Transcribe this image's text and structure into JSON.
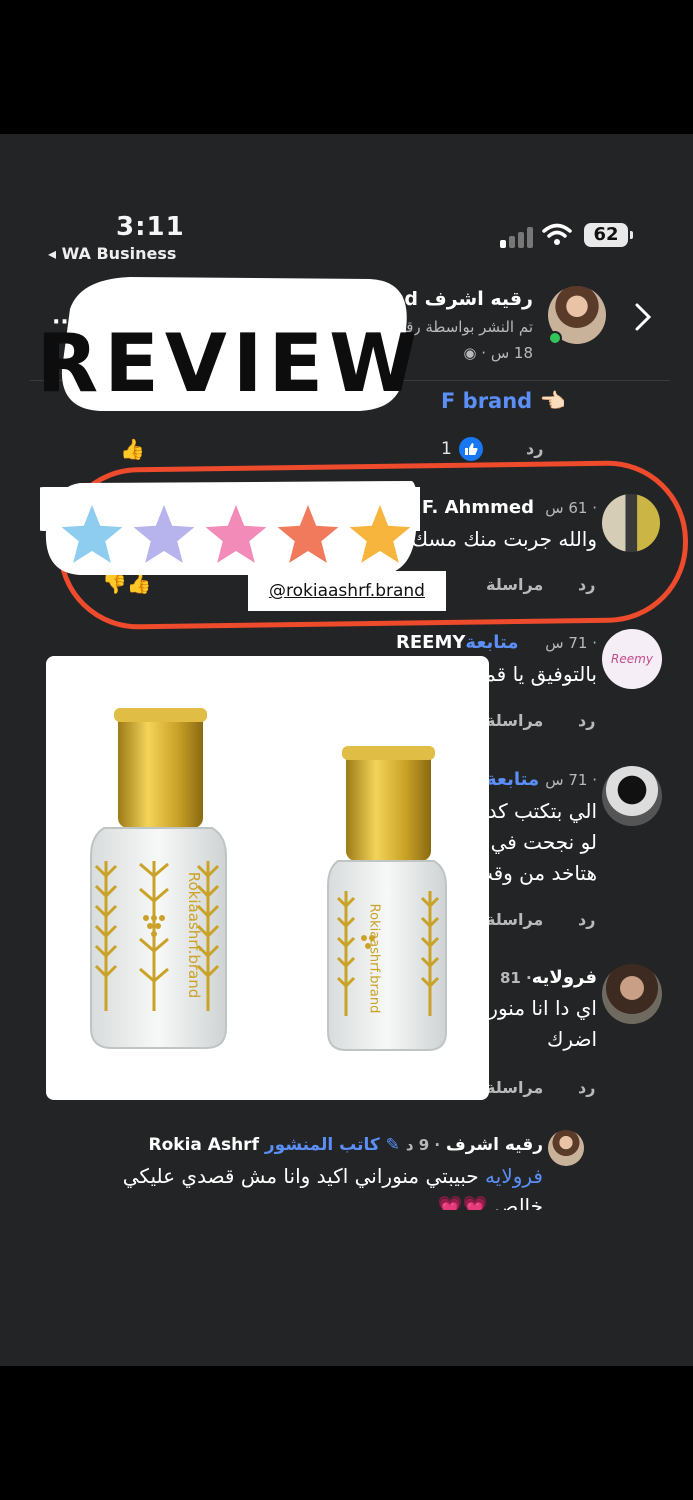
{
  "status_bar": {
    "time": "3:11",
    "back_app": "◂ WA Business",
    "battery": "62"
  },
  "post": {
    "author": "رقيه اشرف brand",
    "subtitle": "تم النشر بواسطة رقيه",
    "time": "18 س · "
  },
  "sticker": {
    "text": "REVIEW",
    "star_colors": [
      "#8ecdf0",
      "#b7b3ec",
      "#f28bb8",
      "#f27a5c",
      "#f8b53d"
    ]
  },
  "comments": [
    {
      "brand_text": "F brand",
      "reply": "رد",
      "likes": "1"
    },
    {
      "name": "HaDeera F. Ahmmed",
      "meta": "· 61 س",
      "text": "والله جربت منك مسك خطيبييير دي قليله",
      "reply": "رد",
      "message": "مراسلة"
    },
    {
      "name": "REEMY",
      "follow": "متابعة",
      "meta": "· 71 س",
      "text": "بالتوفيق يا قمر",
      "reply": "رد",
      "message": "مراسلة"
    },
    {
      "follow": "متابعة",
      "meta": "· 71 س",
      "lines": [
        "الي بتكتب كده",
        "لو نجحت في",
        "هتاخد من وقت"
      ],
      "reply": "رد",
      "message": "مراسلة"
    },
    {
      "name": "فرولايه",
      "meta": "· 81",
      "lines": [
        "اي دا انا منورا",
        "اضرك"
      ],
      "reply": "رد",
      "message": "مراسلة"
    },
    {
      "name": "رقيه اشرف",
      "name_latin": "Rokia Ashrf",
      "author_badge": "كاتب المنشور",
      "meta": "· 9 د",
      "mention": "فرولايه",
      "text": "حبيبتي منوراني اكيد وانا مش قصدي عليكي",
      "text2": "خالص"
    }
  ],
  "tag": "@rokiaashrf.brand",
  "product": {
    "bottle_text": "Rokiaashrf.brand",
    "cap_color": "#c9a227"
  },
  "colors": {
    "accent": "#5b8ff7",
    "highlight": "#ee4a2c",
    "background": "#232426"
  }
}
